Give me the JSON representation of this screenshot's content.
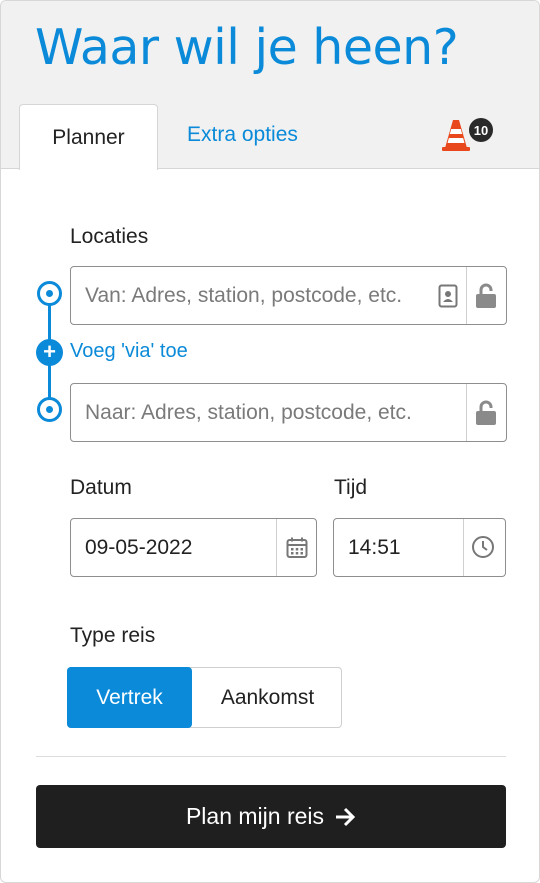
{
  "header": {
    "title": "Waar wil je heen?"
  },
  "tabs": {
    "planner": "Planner",
    "extra": "Extra opties"
  },
  "alert": {
    "count": "10",
    "icon": "traffic-cone-icon",
    "color": "#e8481c"
  },
  "locations": {
    "label": "Locaties",
    "from_placeholder": "Van: Adres, station, postcode, etc.",
    "to_placeholder": "Naar: Adres, station, postcode, etc.",
    "via_label": "Voeg 'via' toe"
  },
  "datetime": {
    "date_label": "Datum",
    "date_value": "09-05-2022",
    "time_label": "Tijd",
    "time_value": "14:51"
  },
  "trip_type": {
    "label": "Type reis",
    "departure": "Vertrek",
    "arrival": "Aankomst",
    "selected": "Vertrek"
  },
  "submit": {
    "label": "Plan mijn reis",
    "icon": "arrow-right-icon"
  },
  "colors": {
    "accent": "#0a8ad8",
    "button_bg": "#1f1f1f",
    "header_bg": "#f1f1f1"
  }
}
